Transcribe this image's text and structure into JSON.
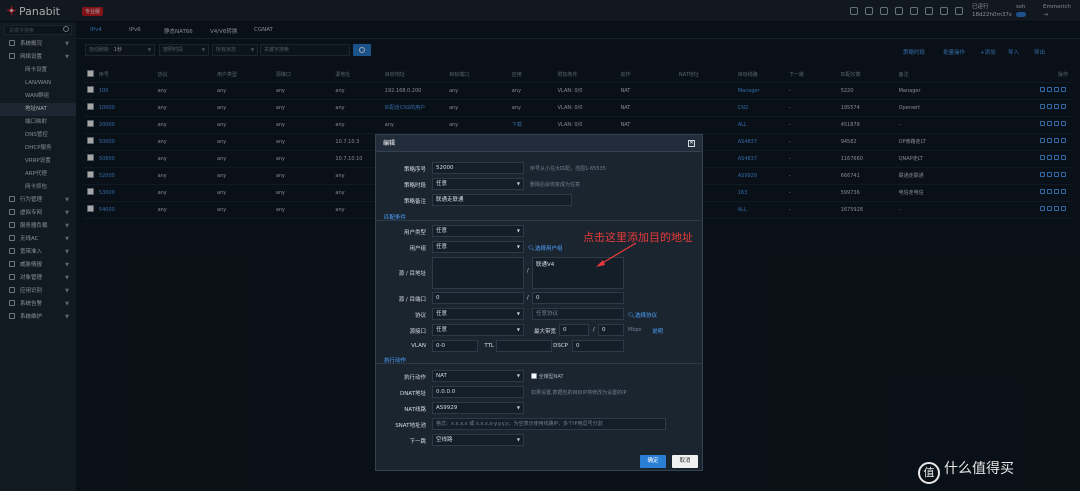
{
  "app": {
    "brand": "Panabit",
    "edition": "专业版"
  },
  "status": {
    "running": "已运行",
    "uptime": "18d22h0m37s",
    "ssh": "ssh",
    "user": "Emmerich"
  },
  "search_placeholder": "关键字搜索",
  "sidebar": [
    {
      "type": "grp",
      "label": "系统概况",
      "icon": "dashboard-icon"
    },
    {
      "type": "grp",
      "label": "网络设置",
      "icon": "network-icon"
    },
    {
      "type": "sub",
      "label": "网卡设置"
    },
    {
      "type": "sub",
      "label": "LAN/WAN"
    },
    {
      "type": "sub",
      "label": "WAN群组"
    },
    {
      "type": "sub",
      "label": "地址NAT",
      "active": true
    },
    {
      "type": "sub",
      "label": "端口映射"
    },
    {
      "type": "sub",
      "label": "DNS管控"
    },
    {
      "type": "sub",
      "label": "DHCP服务"
    },
    {
      "type": "sub",
      "label": "VRRP设置"
    },
    {
      "type": "sub",
      "label": "ARP代理"
    },
    {
      "type": "sub",
      "label": "网卡抓包"
    },
    {
      "type": "grp",
      "label": "行为管理",
      "icon": "behavior-icon"
    },
    {
      "type": "grp",
      "label": "虚拟专网",
      "icon": "vpn-icon"
    },
    {
      "type": "grp",
      "label": "服务器负载",
      "icon": "server-icon"
    },
    {
      "type": "grp",
      "label": "无线AC",
      "icon": "wireless-icon"
    },
    {
      "type": "grp",
      "label": "宽带准入",
      "icon": "access-icon"
    },
    {
      "type": "grp",
      "label": "威胁情报",
      "icon": "threat-icon"
    },
    {
      "type": "grp",
      "label": "对象管理",
      "icon": "object-icon"
    },
    {
      "type": "grp",
      "label": "应用识别",
      "icon": "app-icon"
    },
    {
      "type": "grp",
      "label": "系统告警",
      "icon": "alarm-icon"
    },
    {
      "type": "grp",
      "label": "系统维护",
      "icon": "maintenance-icon"
    }
  ],
  "tabs": [
    "IPv4",
    "IPv6",
    "静态NAT66",
    "V4/V6转换",
    "CGNAT"
  ],
  "filters": {
    "refresh": "自动刷新",
    "interval": "1秒",
    "f2": "按照时段",
    "f3": "所有状态",
    "search": "关键字搜索"
  },
  "actions": [
    "策略时段",
    "批量操作",
    "+添加",
    "导入",
    "导出"
  ],
  "table": {
    "headers": [
      "",
      "序号",
      "协议",
      "用户类型",
      "源接口",
      "源地址",
      "目标地址",
      "目标端口",
      "应用",
      "附加条件",
      "动作",
      "NAT地址",
      "目标线路",
      "下一跳",
      "匹配次数",
      "备注",
      "操作"
    ],
    "rows": [
      [
        "100",
        "any",
        "any",
        "any",
        "any",
        "192.168.0.200",
        "any",
        "any",
        "VLAN: 0/0",
        "NAT",
        "",
        "Manager",
        "-",
        "5220",
        "Manager"
      ],
      [
        "10000",
        "any",
        "any",
        "any",
        "any",
        "匹配走CN2的用户",
        "any",
        "any",
        "VLAN: 0/0",
        "NAT",
        "",
        "CN2",
        "-",
        "195574",
        "Openwrt"
      ],
      [
        "20000",
        "any",
        "any",
        "any",
        "any",
        "any",
        "any",
        "下载",
        "VLAN: 0/0",
        "NAT",
        "",
        "ALL",
        "-",
        "451878",
        "-"
      ],
      [
        "50000",
        "any",
        "any",
        "any",
        "10.7.10.3",
        "",
        "",
        "",
        "",
        "",
        "",
        "AS4837",
        "-",
        "94582",
        "OP旁路走LT"
      ],
      [
        "50800",
        "any",
        "any",
        "any",
        "10.7.10.10",
        "",
        "",
        "",
        "",
        "",
        "",
        "AS4837",
        "-",
        "1167660",
        "QNAP走LT"
      ],
      [
        "52000",
        "any",
        "any",
        "any",
        "any",
        "",
        "",
        "",
        "",
        "",
        "",
        "AS9929",
        "-",
        "666741",
        "联通走联通"
      ],
      [
        "53000",
        "any",
        "any",
        "any",
        "any",
        "",
        "",
        "",
        "",
        "",
        "",
        "163",
        "-",
        "599736",
        "电信走电信"
      ],
      [
        "54000",
        "any",
        "any",
        "any",
        "any",
        "",
        "",
        "",
        "",
        "",
        "",
        "ALL",
        "-",
        "1675928",
        "-"
      ]
    ]
  },
  "modal": {
    "title": "编辑",
    "seq_label": "策略序号",
    "seq": "52000",
    "seq_hint": "序号从小往大匹配，范围1-65535",
    "period_label": "策略时段",
    "period": "任意",
    "period_hint": "删除后会恢复成为任意",
    "note_label": "策略备注",
    "note": "联通走联通",
    "match_title": "匹配条件",
    "utype_label": "用户类型",
    "utype": "任意",
    "ugroup_label": "用户组",
    "ugroup": "任意",
    "ugroup_link": "选择用户组",
    "srcdst_label": "源 / 目地址",
    "dst": "联通V4",
    "port_label": "源 / 目端口",
    "sport": "0",
    "dport": "0",
    "proto_label": "协议",
    "proto": "任意",
    "proto_hint": "任意协议",
    "proto_link": "选择协议",
    "iface_label": "源接口",
    "iface": "任意",
    "bw_label": "最大带宽",
    "bw1": "0",
    "bw2": "0",
    "bw_unit": "Mbps",
    "bw_link": "说明",
    "vlan_label": "VLAN",
    "vlan": "0-0",
    "ttl_label": "TTL",
    "dscp_label": "DSCP",
    "dscp": "0",
    "exec_title": "执行动作",
    "action_label": "执行动作",
    "action": "NAT",
    "fullcone": "全锥型NAT",
    "dnat_label": "DNAT地址",
    "dnat": "0.0.0.0",
    "dnat_hint": "如果设置,数据包的目标IP将修改为设置的IP",
    "line_label": "NAT线路",
    "line": "AS9929",
    "snat_label": "SNAT地址池",
    "snat_placeholder": "格式：x.x.x.x 或 x.x.x.x-y.y.y.y，为空表示使用线路IP，多个IP用逗号分割",
    "next_label": "下一跳",
    "next": "空线路",
    "ok": "确定",
    "cancel": "取消"
  },
  "annotation": "点击这里添加目的地址",
  "watermark": "什么值得买",
  "watermark_mark": "值"
}
